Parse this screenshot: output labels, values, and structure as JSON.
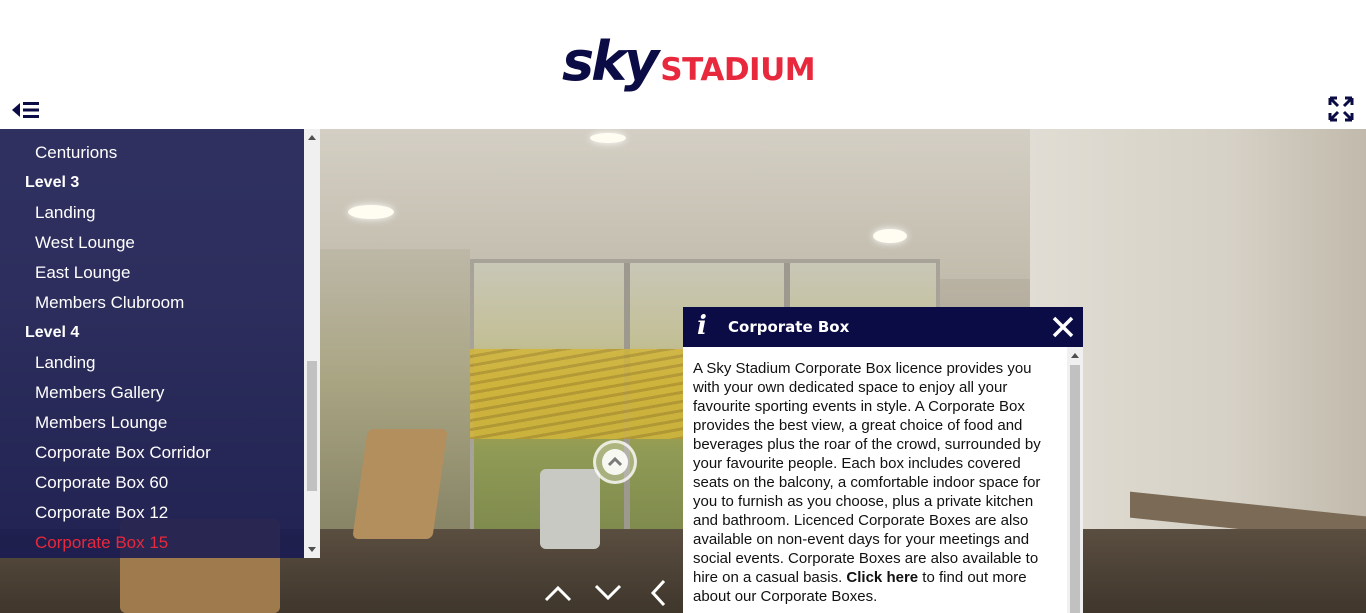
{
  "header": {
    "logo_sky": "sky",
    "logo_stadium": "STADIUM",
    "brand_colors": {
      "navy": "#0b0b45",
      "red": "#e8283c"
    }
  },
  "sidebar": {
    "items": [
      {
        "label": "Centurions",
        "type": "item"
      },
      {
        "label": "Level 3",
        "type": "heading"
      },
      {
        "label": "Landing",
        "type": "item"
      },
      {
        "label": "West Lounge",
        "type": "item"
      },
      {
        "label": "East Lounge",
        "type": "item"
      },
      {
        "label": "Members Clubroom",
        "type": "item"
      },
      {
        "label": "Level 4",
        "type": "heading"
      },
      {
        "label": "Landing",
        "type": "item"
      },
      {
        "label": "Members Gallery",
        "type": "item"
      },
      {
        "label": "Members Lounge",
        "type": "item"
      },
      {
        "label": "Corporate Box Corridor",
        "type": "item"
      },
      {
        "label": "Corporate Box 60",
        "type": "item"
      },
      {
        "label": "Corporate Box 12",
        "type": "item"
      },
      {
        "label": "Corporate Box 15",
        "type": "item",
        "active": true
      }
    ]
  },
  "info_panel": {
    "icon": "i",
    "title": "Corporate Box",
    "body_text": "A Sky Stadium Corporate Box licence provides you with your own dedicated space to enjoy all your favourite sporting events in style. A Corporate Box provides the best view, a great choice of food and beverages plus the roar of the crowd, surrounded by your favourite people. Each box includes covered seats on the balcony, a comfortable indoor space for you to furnish as you choose, plus a private kitchen and bathroom. Licenced Corporate Boxes are also available on non-event days for your meetings and social events. Corporate Boxes are also available to hire on a casual basis. ",
    "link_text": "Click here",
    "body_tail": " to find out more about our Corporate Boxes."
  },
  "icons": {
    "menu": "menu-toggle-icon",
    "fullscreen": "fullscreen-icon",
    "close": "close-icon",
    "hotspot": "chevron-up-icon",
    "nav_up": "chevron-up-icon",
    "nav_down": "chevron-down-icon",
    "nav_left": "chevron-left-icon"
  }
}
